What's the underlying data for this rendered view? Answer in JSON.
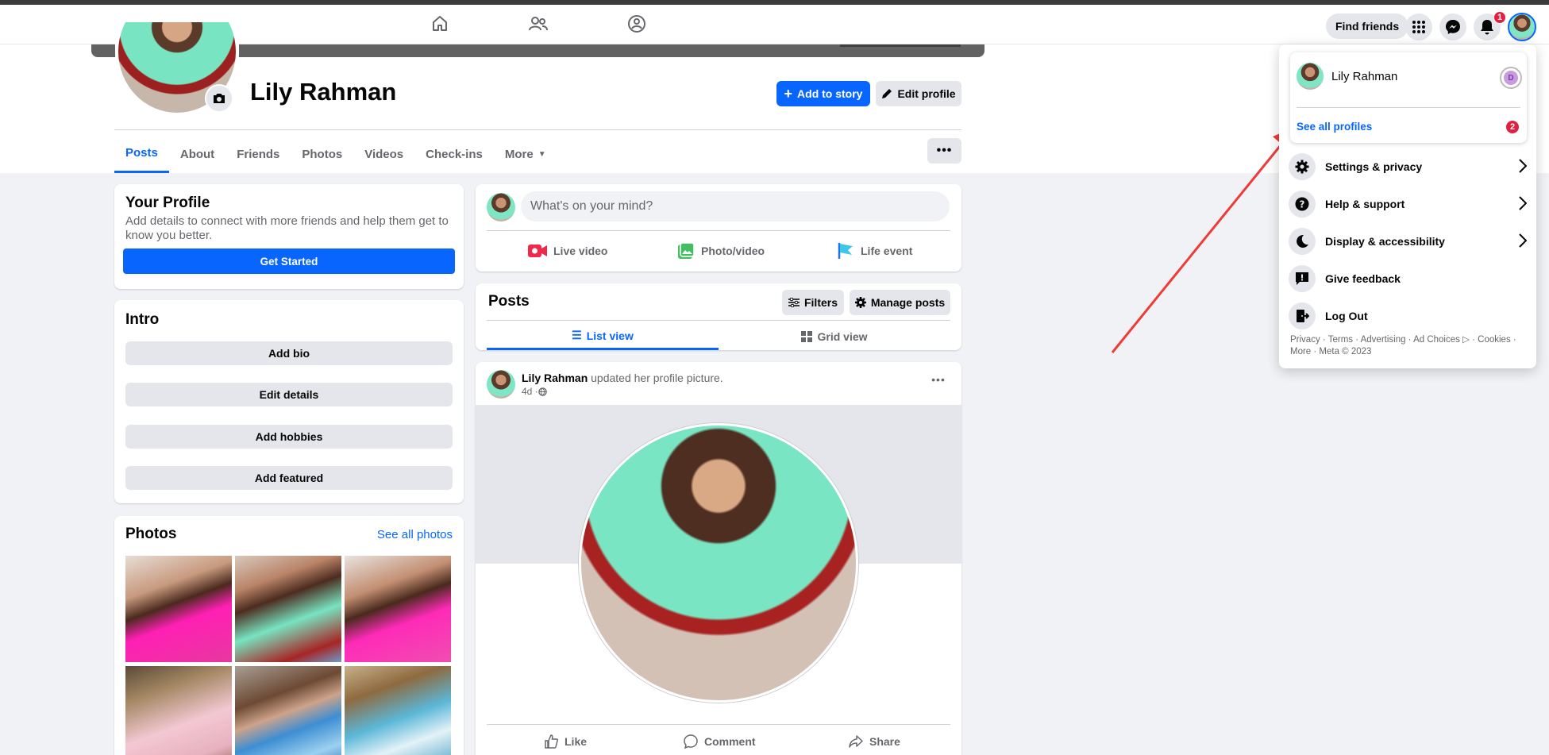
{
  "nav": {
    "find_friends": "Find friends",
    "notification_count": "1",
    "icons": [
      "home-icon",
      "friends-icon",
      "groups-icon",
      "menu-grid-icon",
      "messenger-icon",
      "bell-icon"
    ]
  },
  "profile": {
    "name": "Lily Rahman",
    "add_to_story": "Add to story",
    "edit_profile": "Edit profile"
  },
  "tabs": [
    {
      "label": "Posts"
    },
    {
      "label": "About"
    },
    {
      "label": "Friends"
    },
    {
      "label": "Photos"
    },
    {
      "label": "Videos"
    },
    {
      "label": "Check-ins"
    },
    {
      "label": "More"
    }
  ],
  "your_profile": {
    "title": "Your Profile",
    "description": "Add details to connect with more friends and help them get to know you better.",
    "button": "Get Started"
  },
  "intro": {
    "title": "Intro",
    "buttons": [
      "Add bio",
      "Edit details",
      "Add hobbies",
      "Add featured"
    ]
  },
  "photos": {
    "title": "Photos",
    "see_all": "See all photos"
  },
  "composer": {
    "placeholder": "What's on your mind?",
    "live_video": "Live video",
    "photo_video": "Photo/video",
    "life_event": "Life event"
  },
  "posts_header": {
    "title": "Posts",
    "filters": "Filters",
    "manage_posts": "Manage posts",
    "list_view": "List view",
    "grid_view": "Grid view"
  },
  "post": {
    "author": "Lily Rahman",
    "action": " updated her profile picture.",
    "time": "4d · ",
    "like": "Like",
    "comment": "Comment",
    "share": "Share"
  },
  "account_menu": {
    "profile_name": "Lily Rahman",
    "see_all_profiles": "See all profiles",
    "profiles_badge": "2",
    "items": [
      {
        "label": "Settings & privacy",
        "icon": "gear-icon"
      },
      {
        "label": "Help & support",
        "icon": "question-icon"
      },
      {
        "label": "Display & accessibility",
        "icon": "moon-icon"
      },
      {
        "label": "Give feedback",
        "icon": "feedback-icon"
      },
      {
        "label": "Log Out",
        "icon": "logout-icon"
      }
    ],
    "footer": "Privacy · Terms · Advertising · Ad Choices ▷ · Cookies · More · Meta © 2023"
  },
  "colors": {
    "accent": "#0866ff",
    "annotation_arrow": "#ef3b36",
    "badge": "#e41e3f"
  }
}
